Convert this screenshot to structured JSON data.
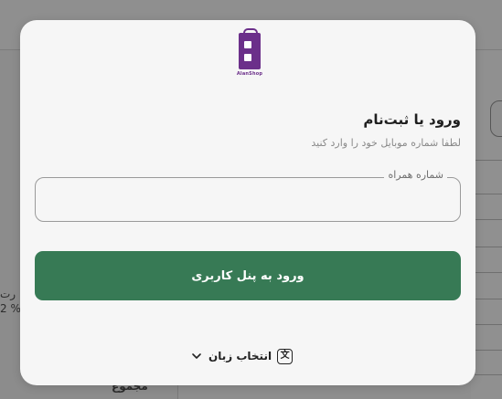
{
  "background": {
    "left_text_1": "رت",
    "left_text_2": "% 2",
    "left_bottom_text": "مجموع"
  },
  "logo": {
    "text": "AlanShop"
  },
  "login": {
    "title": "ورود یا ثبت‌نام",
    "subtitle": "لطفا شماره موبایل خود را وارد کنید",
    "phone_label": "شماره همراه",
    "phone_value": "",
    "submit_label": "ورود به پنل کاربری"
  },
  "language": {
    "label": "انتخاب زبان",
    "icon": "translate-icon",
    "chevron": "chevron-down-icon"
  },
  "colors": {
    "primary_button": "#377a55",
    "brand": "#6b2f8a",
    "overlay": "#8e8e8e"
  }
}
